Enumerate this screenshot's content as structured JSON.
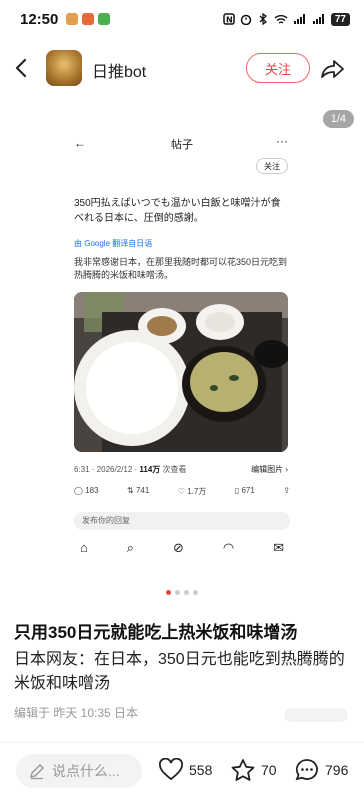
{
  "status": {
    "time": "12:50",
    "battery": "77"
  },
  "header": {
    "account_name": "日推bot",
    "follow_label": "关注"
  },
  "image": {
    "counter": "1/4"
  },
  "screenshot": {
    "title": "帖子",
    "follow_label": "关注",
    "text": "350円払えばいつでも温かい白飯と味噌汁が食べれる日本に、圧倒的感謝。",
    "google_prefix": "由 Google",
    "google_suffix": "翻译自日语",
    "translation": "我非常感谢日本，在那里我随时都可以花350日元吃到热腾腾的米饭和味噌汤。",
    "meta_date": "6:31 · 2026/2/12 · ",
    "meta_views_num": "114万",
    "meta_views_label": " 次查看",
    "edit_label": "编辑图片 ›",
    "stats": {
      "replies": "183",
      "retweets": "741",
      "likes": "1.7万",
      "bookmarks": "671"
    },
    "reply_placeholder": "发布你的回复"
  },
  "post": {
    "title": "只用350日元就能吃上热米饭和味增汤",
    "body": "日本网友：在日本，350日元也能吃到热腾腾的米饭和味噌汤",
    "meta": "编辑于  昨天 10:35 日本"
  },
  "bottom": {
    "comment_placeholder": "说点什么...",
    "likes": "558",
    "favorites": "70",
    "comments": "796"
  },
  "colors": {
    "accent": "#e04848"
  }
}
